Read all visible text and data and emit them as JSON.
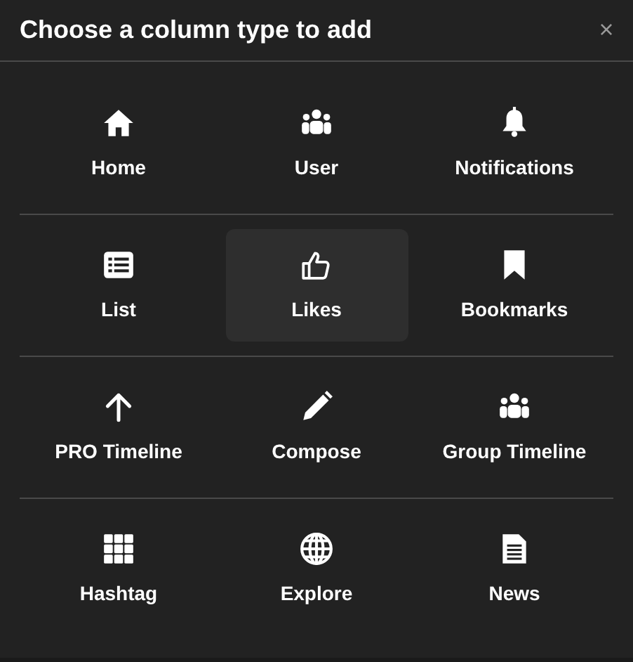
{
  "dialog": {
    "title": "Choose a column type to add",
    "close": "×"
  },
  "rows": [
    {
      "items": [
        {
          "label": "Home",
          "kind": "home",
          "selected": false
        },
        {
          "label": "User",
          "kind": "people",
          "selected": false
        },
        {
          "label": "Notifications",
          "kind": "bell",
          "selected": false
        }
      ]
    },
    {
      "items": [
        {
          "label": "List",
          "kind": "list",
          "selected": false
        },
        {
          "label": "Likes",
          "kind": "thumb",
          "selected": true
        },
        {
          "label": "Bookmarks",
          "kind": "bookmark",
          "selected": false
        }
      ]
    },
    {
      "items": [
        {
          "label": "PRO Timeline",
          "kind": "arrow",
          "selected": false
        },
        {
          "label": "Compose",
          "kind": "pencil",
          "selected": false
        },
        {
          "label": "Group Timeline",
          "kind": "people",
          "selected": false
        }
      ]
    },
    {
      "items": [
        {
          "label": "Hashtag",
          "kind": "grid",
          "selected": false
        },
        {
          "label": "Explore",
          "kind": "globe",
          "selected": false
        },
        {
          "label": "News",
          "kind": "document",
          "selected": false
        }
      ]
    }
  ]
}
